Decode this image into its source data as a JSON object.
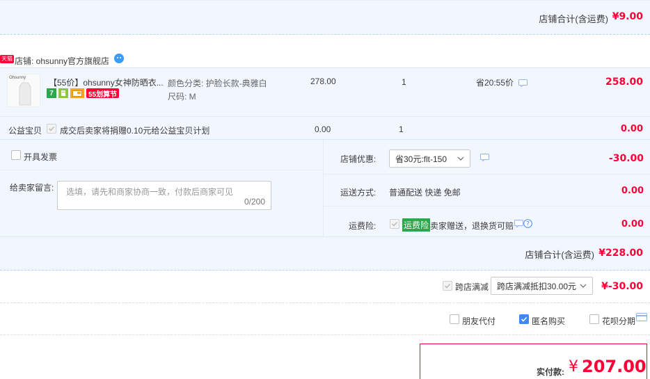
{
  "top_total": {
    "label": "店铺合计(含运费)",
    "value": "¥9.00"
  },
  "shop": {
    "badge": "天猫",
    "name": "店铺: ohsunny官方旗舰店"
  },
  "item": {
    "thumb_text": "Ohsunny",
    "title": "【55价】ohsunny女神防晒衣...",
    "badge_7": "7",
    "badge_55": "55划算节",
    "attr_color": "颜色分类: 护脸长款-典雅白",
    "attr_size": "尺码: M",
    "unit_price": "278.00",
    "qty": "1",
    "discount": "省20:55价",
    "subtotal": "258.00"
  },
  "charity": {
    "label": "公益宝贝",
    "text": "成交后卖家将捐赠0.10元给公益宝贝计划",
    "price": "0.00",
    "qty": "1",
    "subtotal": "0.00"
  },
  "invoice": {
    "label": "开具发票"
  },
  "message": {
    "label": "给卖家留言:",
    "placeholder": "选填，请先和商家协商一致，付款后商家可见",
    "counter": "0/200"
  },
  "coupon": {
    "label": "店铺优惠:",
    "selected": "省30元:flt-150",
    "value": "-30.00"
  },
  "shipping": {
    "label": "运送方式:",
    "text": "普通配送 快递 免邮",
    "value": "0.00"
  },
  "insurance": {
    "label": "运费险:",
    "tag": "运费险",
    "text": "卖家赠送，退换货可赔",
    "value": "0.00"
  },
  "shop_total": {
    "label": "店铺合计(含运费)",
    "value": "¥228.00"
  },
  "cross_store": {
    "label": "跨店满减",
    "selected": "跨店满减抵扣30.00元",
    "value": "¥-30.00"
  },
  "options": {
    "friend_pay": "朋友代付",
    "anonymous": "匿名购买",
    "huabei": "花呗分期"
  },
  "final": {
    "label": "实付款:",
    "currency": "¥",
    "amount": "207.00"
  },
  "colors": {
    "accent_red": "#ff0036",
    "blue_bg": "#f2f7ff",
    "dashed_border": "#b2d1ff",
    "green_tag": "#29a94b"
  }
}
